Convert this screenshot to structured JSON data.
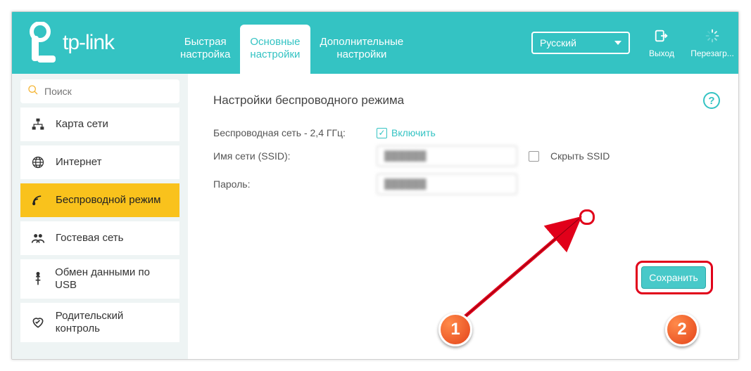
{
  "brand": "tp-link",
  "header": {
    "tabs": [
      "Быстрая\nнастройка",
      "Основные\nнастройки",
      "Дополнительные\nнастройки"
    ],
    "active_tab_index": 1,
    "language": "Русский",
    "logout_label": "Выход",
    "reboot_label": "Перезагр..."
  },
  "sidebar": {
    "search_placeholder": "Поиск",
    "items": [
      {
        "label": "Карта сети",
        "icon": "network-map-icon"
      },
      {
        "label": "Интернет",
        "icon": "globe-icon"
      },
      {
        "label": "Беспроводной режим",
        "icon": "wifi-icon"
      },
      {
        "label": "Гостевая сеть",
        "icon": "guest-icon"
      },
      {
        "label": "Обмен данными по USB",
        "icon": "usb-icon"
      },
      {
        "label": "Родительский контроль",
        "icon": "heart-icon"
      }
    ],
    "active_index": 2
  },
  "page": {
    "title": "Настройки беспроводного режима",
    "rows": {
      "band_label": "Беспроводная сеть - 2,4 ГГц:",
      "enable_label": "Включить",
      "enable_checked": true,
      "ssid_label": "Имя сети (SSID):",
      "ssid_value": "██████",
      "hide_ssid_label": "Скрыть SSID",
      "hide_ssid_checked": false,
      "password_label": "Пароль:",
      "password_value": "██████"
    },
    "save_label": "Сохранить"
  },
  "annotations": {
    "callout1": "1",
    "callout2": "2"
  }
}
